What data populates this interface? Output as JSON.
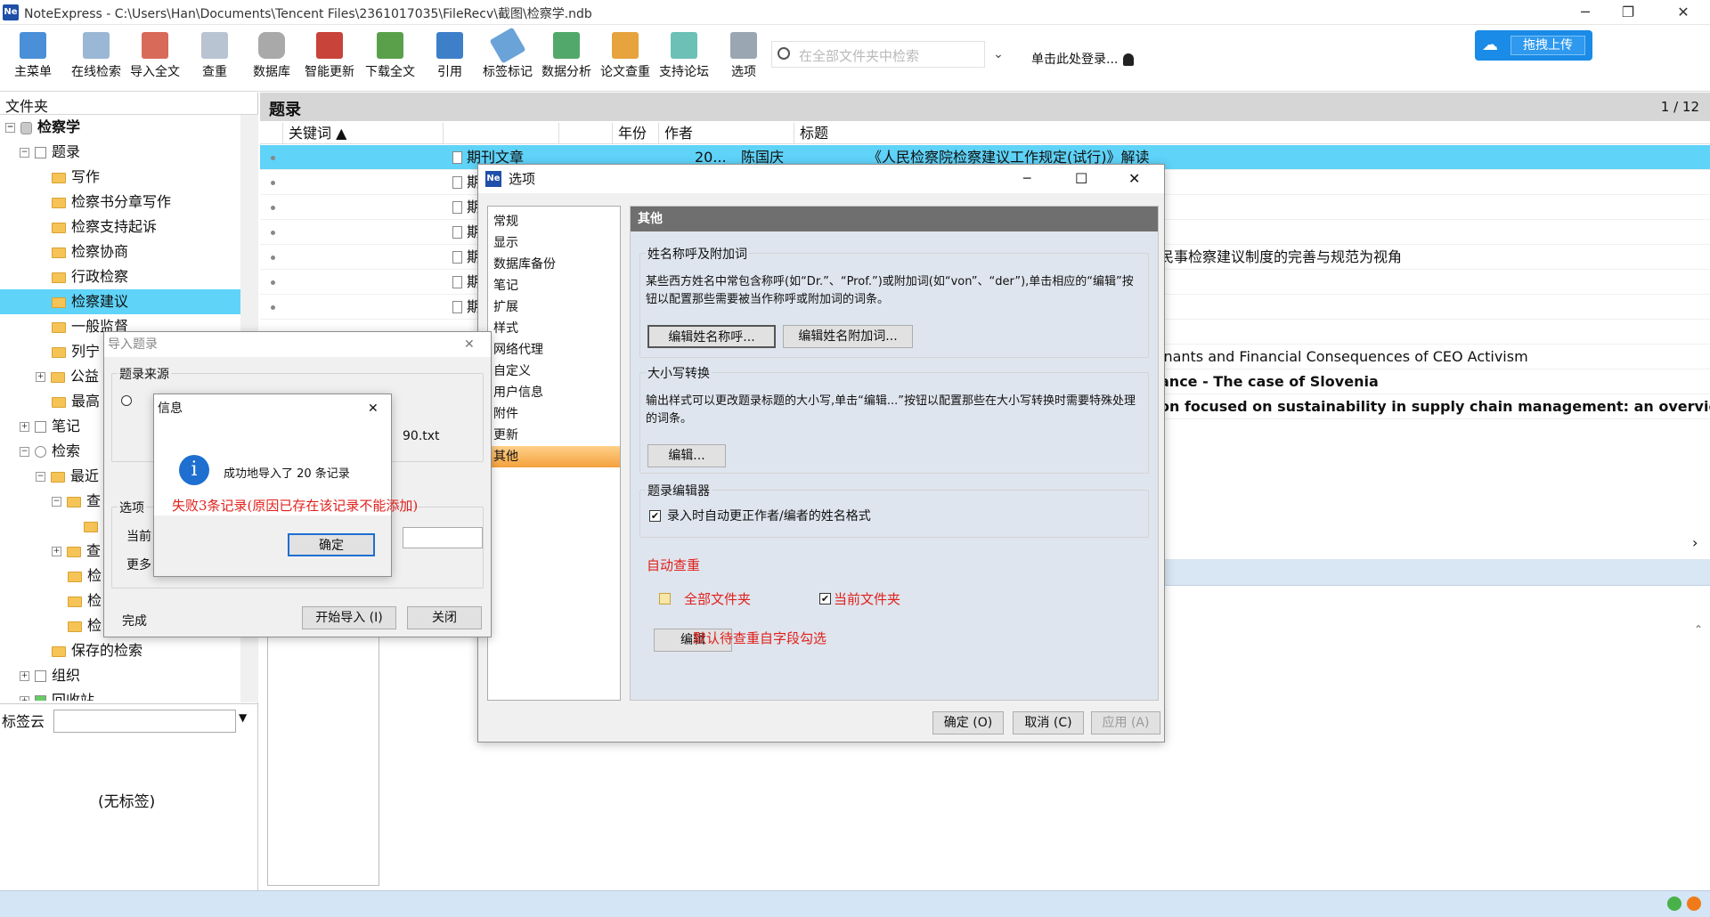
{
  "app": {
    "title": "NoteExpress - C:\\Users\\Han\\Documents\\Tencent Files\\2361017035\\FileRecv\\截图\\检察学.ndb"
  },
  "toolbar": {
    "items": [
      "主菜单",
      "在线检索",
      "导入全文",
      "查重",
      "数据库",
      "智能更新",
      "下载全文",
      "引用",
      "标签标记",
      "数据分析",
      "论文查重",
      "支持论坛",
      "选项"
    ],
    "search_placeholder": "在全部文件夹中检索",
    "login": "单击此处登录...",
    "upload": "拖拽上传"
  },
  "sidebar": {
    "header": "文件夹",
    "tree": [
      "检察学",
      "题录",
      "写作",
      "检察书分章写作",
      "检察支持起诉",
      "检察协商",
      "行政检察",
      "检察建议",
      "一般监督",
      "列宁",
      "公益",
      "最高",
      "笔记",
      "检索",
      "最近",
      "查",
      "查",
      "检",
      "检",
      "检",
      "保存的检索",
      "组织",
      "回收站"
    ],
    "tag_label": "标签云",
    "no_tags": "(无标签)"
  },
  "main": {
    "title": "题录",
    "page": "1 / 12",
    "columns": [
      "关键词",
      "年份",
      "作者",
      "标题"
    ],
    "rows": [
      {
        "type": "期刊文章",
        "year": "20...",
        "author": "陈国庆",
        "title": "《人民检察院检察建议工作规定(试行)》解读",
        "selected": true
      },
      {
        "type": "期",
        "title": ""
      },
      {
        "type": "期",
        "title": ""
      },
      {
        "type": "期",
        "title": ""
      },
      {
        "type": "期",
        "title": "民事检察建议制度的完善与规范为视角"
      },
      {
        "type": "期",
        "title": ""
      },
      {
        "type": "期",
        "title": ""
      },
      {
        "type": "",
        "title": ""
      },
      {
        "type": "",
        "title": "inants and Financial Consequences of CEO Activism"
      },
      {
        "type": "",
        "title": "ance - The case of Slovenia",
        "bold": true
      },
      {
        "type": "",
        "title": "on focused on sustainability in supply chain management: an overview o",
        "bold": true
      }
    ]
  },
  "import_dialog": {
    "title": "导入题录",
    "source_group": "题录来源",
    "file_suffix": "90.txt",
    "options_group": "选项",
    "current_label": "当前",
    "more": "更多",
    "status": "完成",
    "start_btn": "开始导入 (I)",
    "close_btn": "关闭"
  },
  "info_dialog": {
    "title": "信息",
    "message": "成功地导入了 20 条记录",
    "note": "失败3条记录(原因已存在该记录不能添加)",
    "ok": "确定"
  },
  "options_dialog": {
    "title": "选项",
    "nav": [
      "常规",
      "显示",
      "数据库备份",
      "笔记",
      "扩展",
      "样式",
      "网络代理",
      "自定义",
      "用户信息",
      "附件",
      "更新",
      "其他"
    ],
    "selected_nav": "其他",
    "panel_title": "其他",
    "name_group": "姓名称呼及附加词",
    "name_desc": "某些西方姓名中常包含称呼(如“Dr.”、“Prof.”)或附加词(如“von”、“der”),单击相应的“编辑”按钮以配置那些需要被当作称呼或附加词的词条。",
    "edit_title_btn": "编辑姓名称呼...",
    "edit_affix_btn": "编辑姓名附加词...",
    "case_group": "大小写转换",
    "case_desc": "输出样式可以更改题录标题的大小写,单击“编辑...”按钮以配置那些在大小写转换时需要特殊处理的词条。",
    "edit_btn": "编辑...",
    "editor_group": "题录编辑器",
    "auto_fix": "录入时自动更正作者/编者的姓名格式",
    "dup_title": "自动查重",
    "all_folders": "全部文件夹",
    "current_folder": "当前文件夹",
    "dup_edit": "编辑",
    "dup_note": "默认待查重自字段勾选",
    "ok": "确定 (O)",
    "cancel": "取消 (C)",
    "apply": "应用 (A)"
  }
}
